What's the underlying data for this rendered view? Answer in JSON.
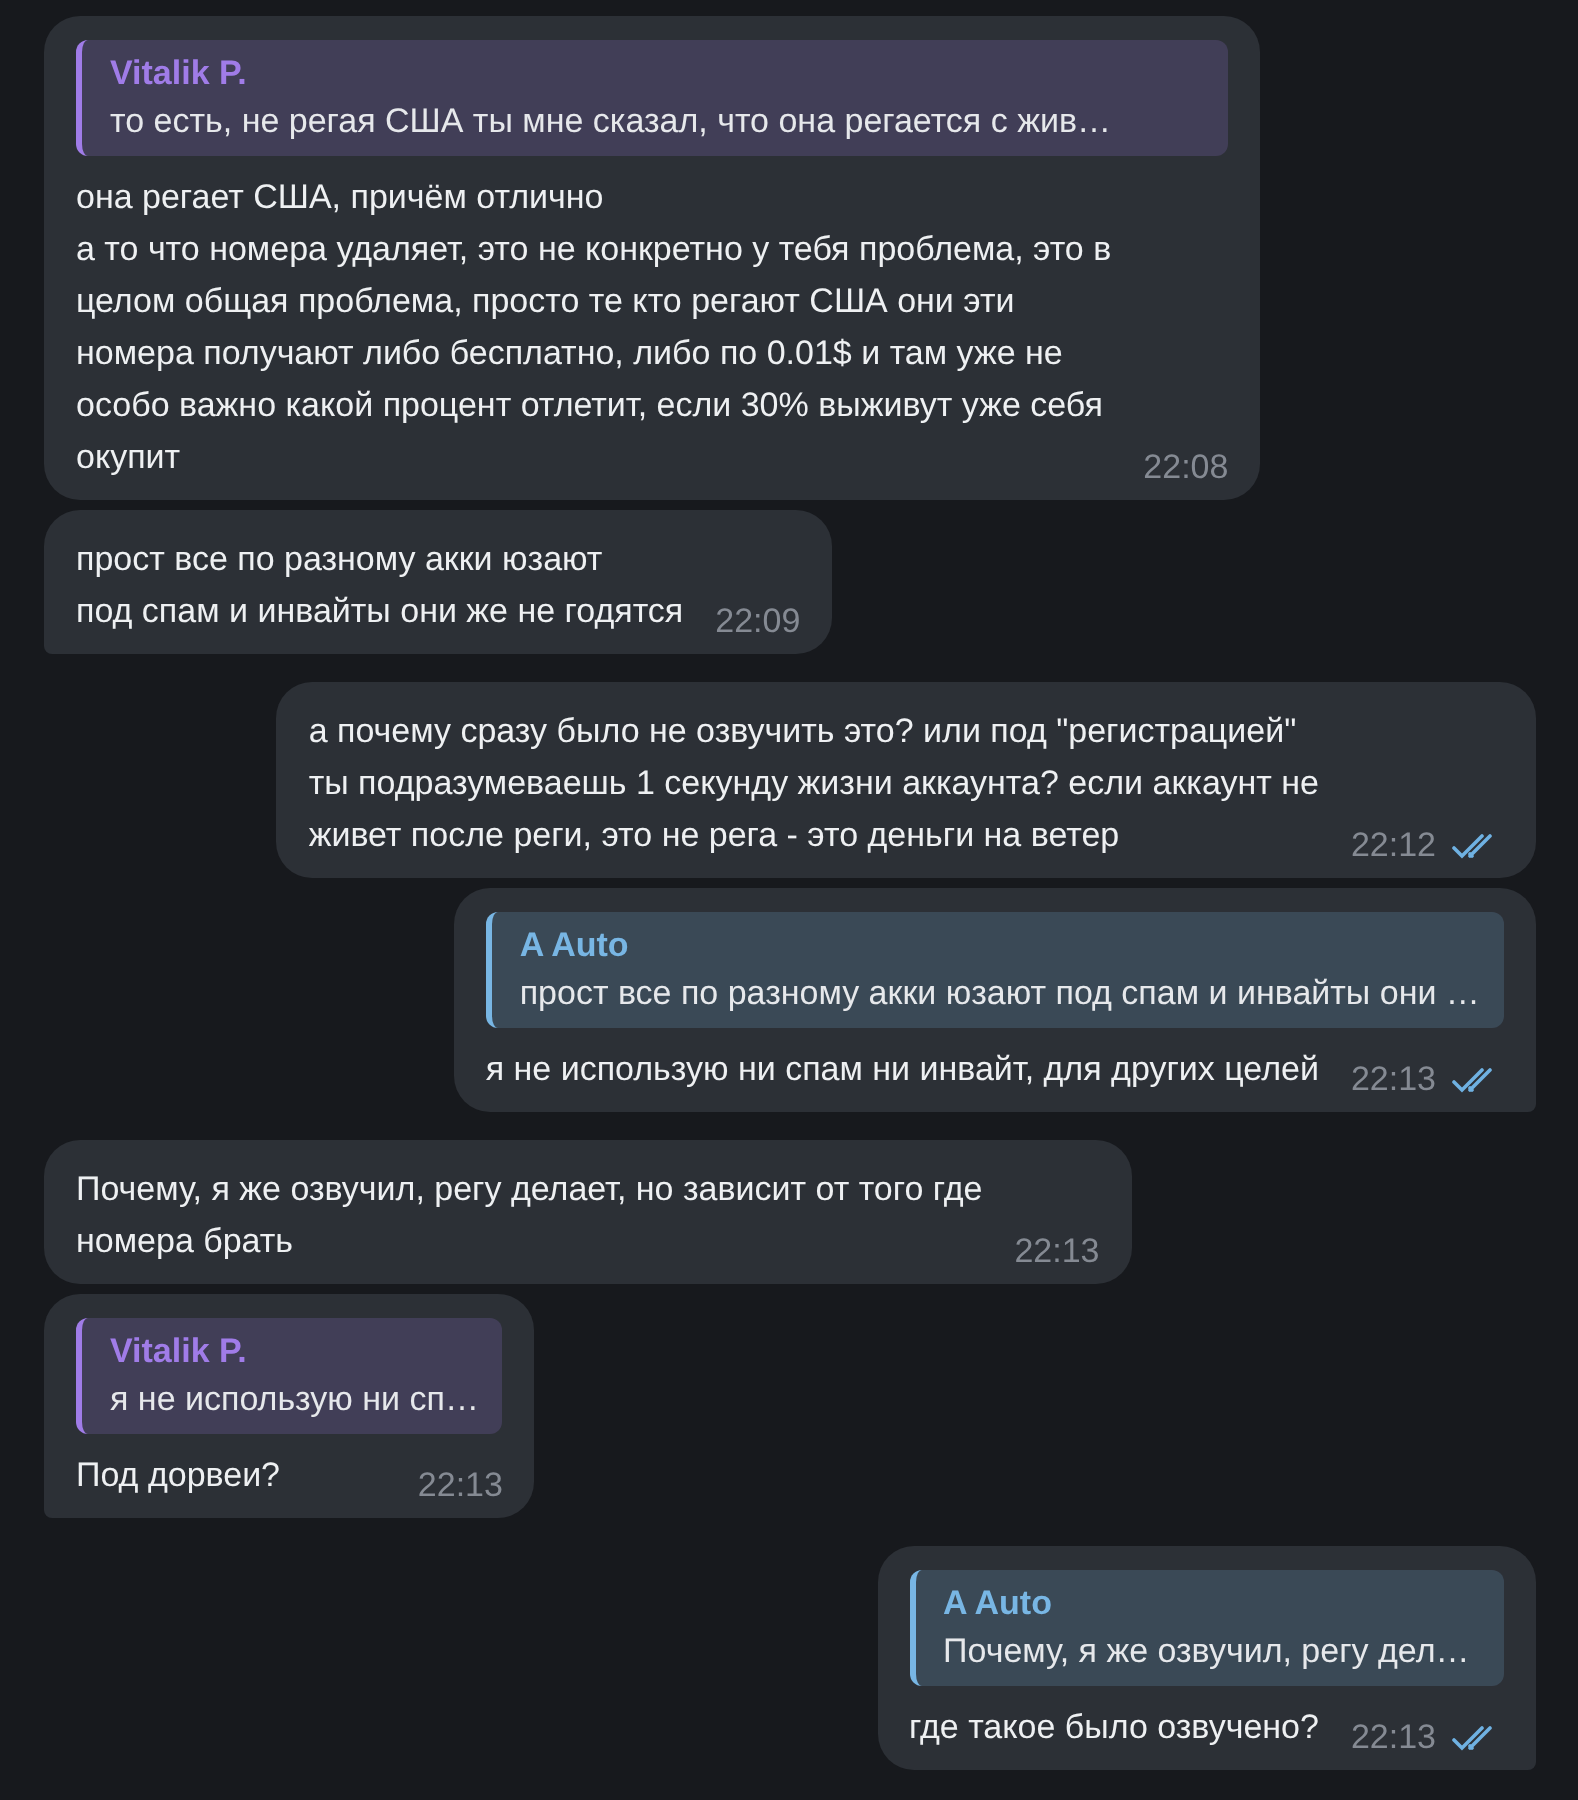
{
  "messages": [
    {
      "kind": "in",
      "tail": false,
      "quote": {
        "author": "Vitalik P.",
        "text": "то есть, не регая США ты мне сказал, что она регается с жив…",
        "color": "#a07ce8"
      },
      "text": "она регает США, причём отлично\nа то что номера удаляет, это не конкретно у тебя проблема, это в\nцелом общая проблема, просто те кто регают США они эти\nномера получают либо бесплатно, либо по 0.01$ и там уже не\nособо важно какой процент отлетит, если 30% выживут уже себя\nокупит",
      "time": "22:08"
    },
    {
      "kind": "in",
      "tail": true,
      "text": "прост все по разному акки юзают\nпод спам и инвайты они же не годятся",
      "time": "22:09"
    },
    {
      "kind": "out",
      "tail": false,
      "text": "а почему сразу было не озвучить это? или под \"регистрацией\"\nты подразумеваешь 1 секунду жизни аккаунта? если аккаунт не\nживет после реги, это не рега - это деньги на ветер",
      "time": "22:12",
      "read": true
    },
    {
      "kind": "out",
      "tail": true,
      "quote": {
        "author": "A Auto",
        "text": "прост все по разному акки юзают под спам и инвайты они …",
        "color": "#78b6e4"
      },
      "text": "я не использую ни спам ни инвайт, для других целей",
      "time": "22:13",
      "read": true
    },
    {
      "kind": "in",
      "tail": false,
      "text": "Почему, я же озвучил, регу делает, но зависит от того где\nномера брать",
      "time": "22:13"
    },
    {
      "kind": "in",
      "tail": true,
      "quote": {
        "author": "Vitalik P.",
        "text": "я не использую ни сп…",
        "color": "#a07ce8"
      },
      "text": "Под дорвеи?",
      "time": "22:13"
    },
    {
      "kind": "out",
      "tail": true,
      "quote": {
        "author": "A Auto",
        "text": "Почему, я же озвучил, регу дел…",
        "color": "#78b6e4"
      },
      "text": "где такое было озвучено?",
      "time": "22:13",
      "read": true
    }
  ]
}
